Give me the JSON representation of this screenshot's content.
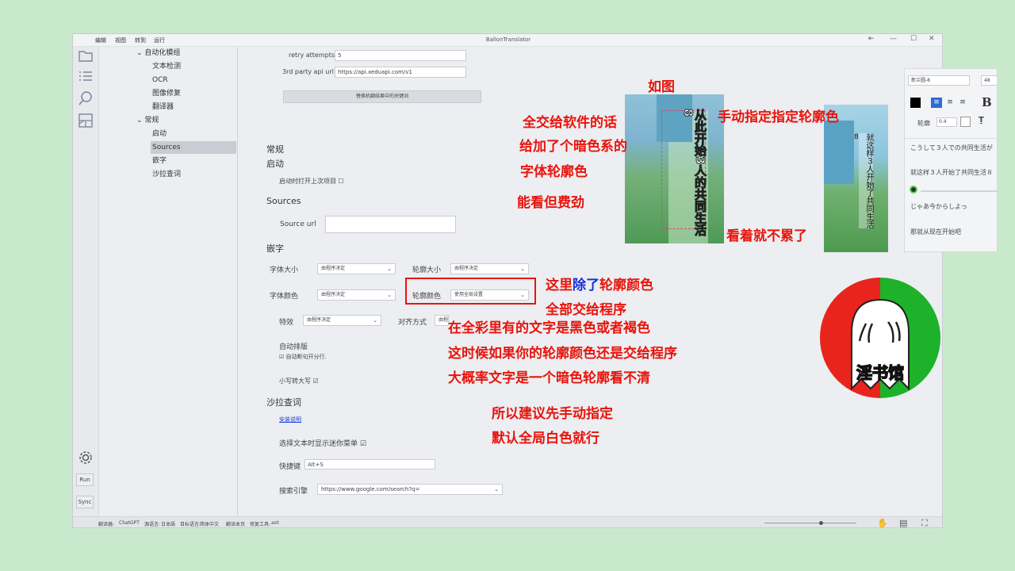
{
  "app": {
    "title": "BallonTranslator",
    "menu": [
      "编辑",
      "视图",
      "转到",
      "运行"
    ]
  },
  "sidebar_buttons": {
    "run": "Run",
    "sync": "Sync"
  },
  "tree": {
    "auto_group": "自动化模组",
    "text_detect": "文本检测",
    "ocr": "OCR",
    "inpaint": "图像修复",
    "translator": "翻译器",
    "general": "常规",
    "startup": "启动",
    "sources": "Sources",
    "typeset": "嵌字",
    "saladict": "沙拉查词"
  },
  "settings": {
    "retry_label": "retry attempts",
    "retry_value": "5",
    "api_label": "3rd party api url",
    "api_value": "https://api.xeduapi.com/v1",
    "replace_btn": "替换机翻结果中的关键词",
    "general_header": "常规",
    "startup_header": "启动",
    "open_last": "启动时打开上次项目 ☐",
    "sources_header": "Sources",
    "source_url_label": "Source url",
    "source_url_value": "",
    "typeset_header": "嵌字",
    "font_size_label": "字体大小",
    "font_size_value": "由程序决定",
    "stroke_size_label": "轮廓大小",
    "stroke_size_value": "由程序决定",
    "font_color_label": "字体颜色",
    "font_color_value": "由程序决定",
    "stroke_color_label": "轮廓颜色",
    "stroke_color_value": "使用全局设置",
    "effect_label": "特效",
    "effect_value": "由程序决定",
    "align_label": "对齐方式",
    "align_value": "由程",
    "auto_layout": "自动排版",
    "auto_wrap": "☑ 自动断句开分行.",
    "upper": "小写转大写 ☑",
    "saladict_header": "沙拉查词",
    "install_link": "安装说明",
    "mini_menu": "选择文本时显示迷你菜单 ☑",
    "shortcut_label": "快捷键",
    "shortcut_value": "Alt+S",
    "search_label": "搜索引擎",
    "search_value": "https://www.google.com/search?q="
  },
  "status": {
    "translator": "翻译器:",
    "translator_value": "ChatGPT",
    "source": "源语言:",
    "source_value": "日本語",
    "target": "目标语言:",
    "target_value": "简体中文",
    "translate_page": "翻译本页",
    "inpaint_tool": "修复工具:",
    "inpaint_value": "aot"
  },
  "right_panel": {
    "font": "新兰圆-8",
    "size": "48",
    "stroke_label": "轮廓",
    "stroke_value": "0.4",
    "line1_ja": "こうして３人での共同生活が",
    "line1_zh": "就这样３人开始了共同生活８",
    "line2_ja": "じゃあ今からしよっ",
    "line2_zh": "那就从现在开始吧"
  },
  "comic": {
    "left_text": "从此开始3人的共同生活8",
    "right_col1": "就这样３人开始了共同生活",
    "right_col2": "8"
  },
  "annotations": {
    "a_example": "如图",
    "a_manual": "手动指定指定轮廓色",
    "a_left1": "全交给软件的话",
    "a_left2": "给加了个暗色系的",
    "a_left3": "字体轮廓色",
    "a_left4": "能看但费劲",
    "a_easy": "看着就不累了",
    "a_here_pre": "这里",
    "a_here_blue": "除了",
    "a_here_post": "轮廓颜色",
    "a_all": "全部交给程序",
    "a_p1": "在全彩里有的文字是黑色或者褐色",
    "a_p2": "这时候如果你的轮廓颜色还是交给程序",
    "a_p3": "大概率文字是一个暗色轮廓看不清",
    "a_s1": "所以建议先手动指定",
    "a_s2": "默认全局白色就行"
  },
  "logo": {
    "text": "淫书馆"
  },
  "colors": {
    "annotation_red": "#e8140c",
    "annotation_blue": "#1a2fd8",
    "link_blue": "#1a3fd8",
    "logo_red": "#e8241c",
    "logo_green": "#1db22a"
  }
}
